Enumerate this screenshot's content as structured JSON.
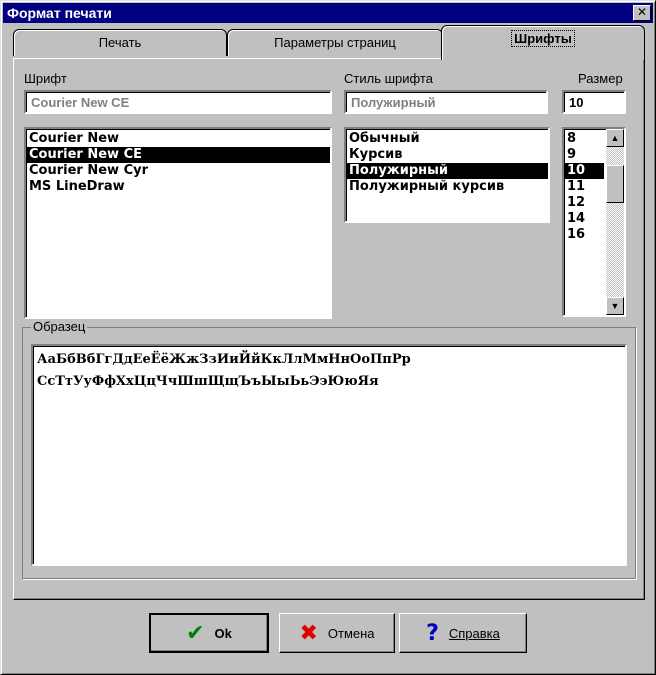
{
  "window": {
    "title": "Формат печати"
  },
  "tabs": [
    {
      "label": "Печать"
    },
    {
      "label": "Параметры страниц"
    },
    {
      "label": "Шрифты"
    }
  ],
  "font": {
    "label": "Шрифт",
    "value": "Courier New CE",
    "items": [
      "Courier New",
      "Courier New CE",
      "Courier New Cyr",
      "MS LineDraw"
    ],
    "selected_index": 1
  },
  "style": {
    "label": "Стиль шрифта",
    "value": "Полужирный",
    "items": [
      "Обычный",
      "Курсив",
      "Полужирный",
      "Полужирный курсив"
    ],
    "selected_index": 2
  },
  "size": {
    "label": "Размер",
    "value": "10",
    "items": [
      "8",
      "9",
      "10",
      "11",
      "12",
      "14",
      "16"
    ],
    "selected_index": 2
  },
  "sample": {
    "label": "Образец",
    "line1": "АаБбВбГгДдЕеЁёЖжЗзИиЙйКкЛлМмНнОоПпРр",
    "line2": "СсТтУуФфХхЦцЧчШшЩщЪъЫыЬьЭэЮюЯя"
  },
  "buttons": {
    "ok": "Ok",
    "cancel": "Отмена",
    "help": "Справка"
  },
  "icons": {
    "ok": "check-icon",
    "cancel": "x-icon",
    "help": "question-icon"
  }
}
